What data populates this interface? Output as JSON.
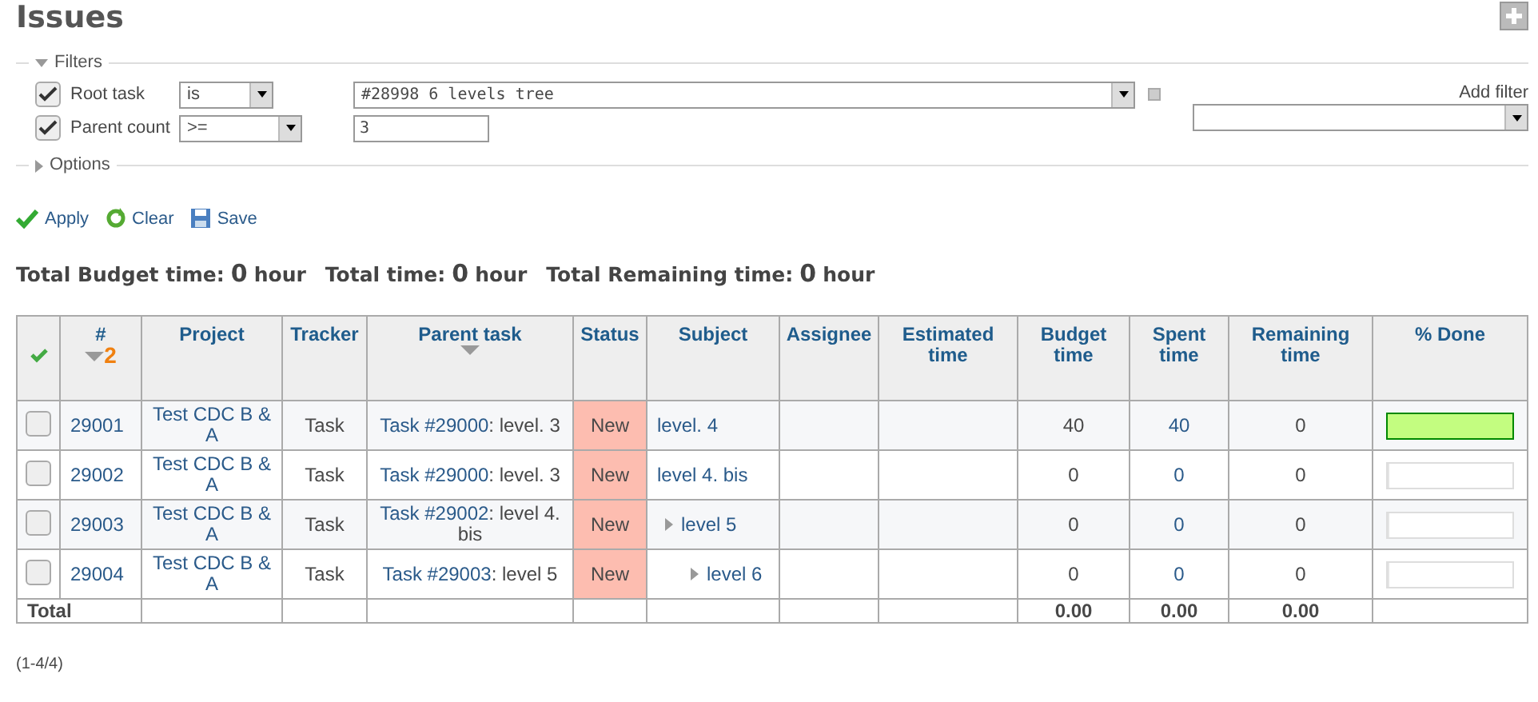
{
  "title": "Issues",
  "filters": {
    "legend": "Filters",
    "expanded": true,
    "rows": [
      {
        "label": "Root task",
        "checked": true,
        "operator": "is",
        "value": "#28998 6 levels tree",
        "kind": "select"
      },
      {
        "label": "Parent count",
        "checked": true,
        "operator": ">=",
        "value": "3",
        "kind": "text"
      }
    ],
    "add_filter": {
      "label": "Add filter"
    }
  },
  "options": {
    "legend": "Options",
    "expanded": false
  },
  "actions": [
    {
      "label": "Apply",
      "kind": "apply"
    },
    {
      "label": "Clear",
      "kind": "clear"
    },
    {
      "label": "Save",
      "kind": "save"
    }
  ],
  "totals": [
    {
      "label": "Total Budget time:",
      "value": "0",
      "unit": "hour"
    },
    {
      "label": "Total time:",
      "value": "0",
      "unit": "hour"
    },
    {
      "label": "Total Remaining time:",
      "value": "0",
      "unit": "hour"
    }
  ],
  "table": {
    "columns": [
      {
        "label": "#",
        "sorted": true,
        "sort_rank": "2"
      },
      {
        "label": "Project",
        "sorted": false
      },
      {
        "label": "Tracker",
        "sorted": false
      },
      {
        "label": "Parent task",
        "sorted": true
      },
      {
        "label": "Status",
        "sorted": false
      },
      {
        "label": "Subject",
        "sorted": false
      },
      {
        "label": "Assignee",
        "sorted": false
      },
      {
        "label": "Estimated time",
        "sorted": false
      },
      {
        "label": "Budget time",
        "sorted": false
      },
      {
        "label": "Spent time",
        "sorted": false
      },
      {
        "label": "Remaining time",
        "sorted": false
      },
      {
        "label": "% Done",
        "sorted": false
      }
    ],
    "rows": [
      {
        "checked": false,
        "id": "29001",
        "project": "Test CDC B & A",
        "tracker": "Task",
        "parent_link": "Task #29000",
        "parent_rest": ": level. 3",
        "status": "New",
        "subject": "level. 4",
        "budget": "40",
        "spent": "40",
        "remaining": "0",
        "level": 1
      },
      {
        "checked": false,
        "id": "29002",
        "project": "Test CDC B & A",
        "tracker": "Task",
        "parent_link": "Task #29000",
        "parent_rest": ": level. 3",
        "status": "New",
        "subject": "level 4. bis",
        "budget": "0",
        "spent": "0",
        "remaining": "0",
        "level": 0,
        "children": [
          {
            "checked": false,
            "id": "29003",
            "project": "Test CDC B & A",
            "tracker": "Task",
            "parent_link": "Task #29002",
            "parent_rest": ": level 4. bis",
            "status": "New",
            "subject": "level 5",
            "budget": "0",
            "spent": "0",
            "remaining": "0",
            "level": 0,
            "children": [
              {
                "checked": false,
                "id": "29004",
                "project": "Test CDC B & A",
                "tracker": "Task",
                "parent_link": "Task #29003",
                "parent_rest": ": level 5",
                "status": "New",
                "subject": "level 6",
                "budget": "0",
                "spent": "0",
                "remaining": "0",
                "level": 0
              }
            ]
          }
        ]
      }
    ],
    "total": {
      "label": "Total",
      "budget": "0.00",
      "spent": "0.00",
      "remaining": "0.00"
    }
  },
  "pagination": "(1-4/4)"
}
